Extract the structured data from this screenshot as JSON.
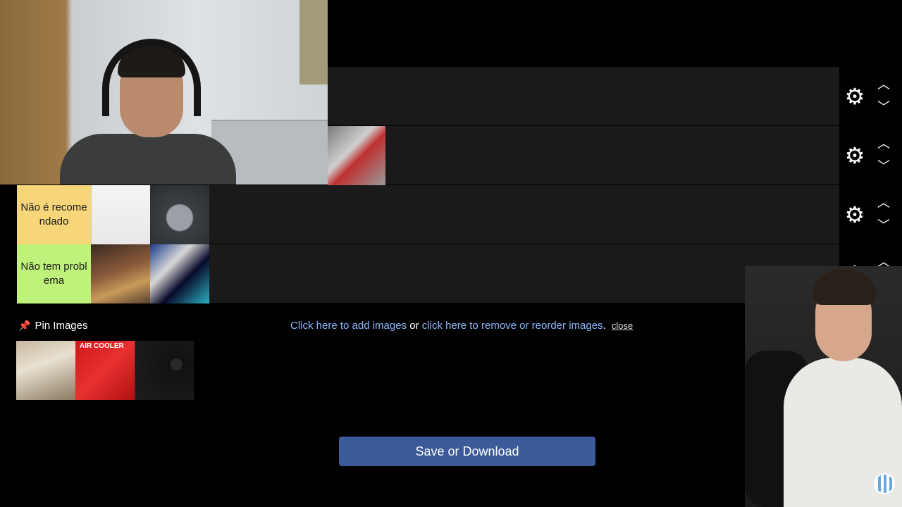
{
  "tiers": [
    {
      "label": "",
      "color": "#1a1a1a",
      "item_count": 0
    },
    {
      "label": "",
      "color": "#1a1a1a",
      "item_count": 1
    },
    {
      "label": "Não é recomendado",
      "color": "#f7d67a",
      "item_count": 2
    },
    {
      "label": "Não tem problema",
      "color": "#bff27a",
      "item_count": 2
    }
  ],
  "controls": {
    "gear_icon": "⚙",
    "up_icon": "︿",
    "down_icon": "﹀"
  },
  "pin": {
    "label": "Pin Images",
    "icon": "📌"
  },
  "links": {
    "add": "Click here to add images",
    "or": " or ",
    "remove": "click here to remove or reorder images",
    "period": ".",
    "close": "close"
  },
  "pool": {
    "air_cooler_label": "AIR COOLER"
  },
  "save_button": "Save or Download",
  "colors": {
    "row_bg": "#1a1a1a",
    "link": "#8fb8ff",
    "button": "#3c5a9a",
    "tier_yellow": "#f7d67a",
    "tier_green": "#bff27a"
  }
}
